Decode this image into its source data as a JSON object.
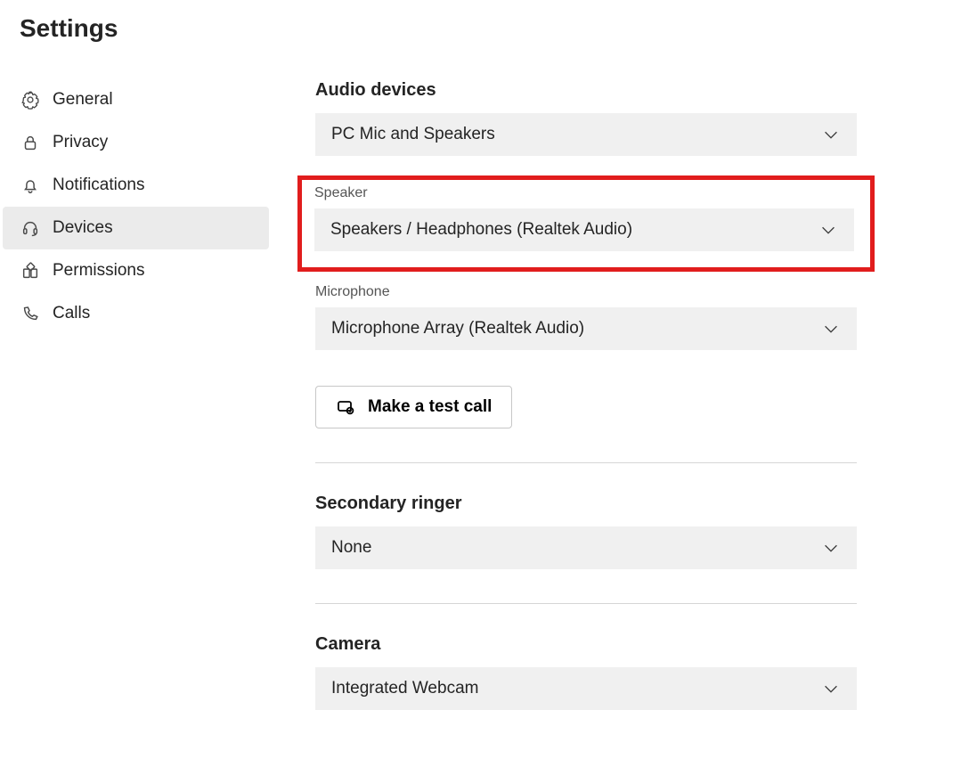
{
  "page_title": "Settings",
  "sidebar": {
    "items": [
      {
        "label": "General"
      },
      {
        "label": "Privacy"
      },
      {
        "label": "Notifications"
      },
      {
        "label": "Devices"
      },
      {
        "label": "Permissions"
      },
      {
        "label": "Calls"
      }
    ],
    "active_index": 3
  },
  "main": {
    "audio_devices_title": "Audio devices",
    "audio_device_value": "PC Mic and Speakers",
    "speaker_label": "Speaker",
    "speaker_value": "Speakers / Headphones (Realtek Audio)",
    "microphone_label": "Microphone",
    "microphone_value": "Microphone Array (Realtek Audio)",
    "test_call_label": "Make a test call",
    "secondary_ringer_title": "Secondary ringer",
    "secondary_ringer_value": "None",
    "camera_title": "Camera",
    "camera_value": "Integrated Webcam"
  }
}
